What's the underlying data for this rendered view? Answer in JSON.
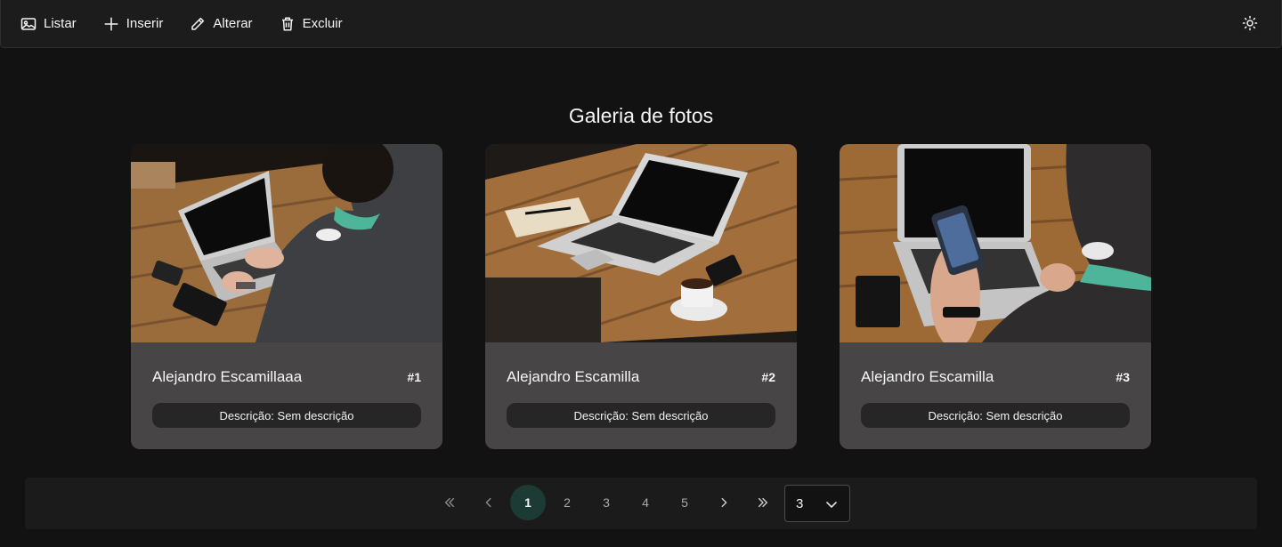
{
  "nav": {
    "list_label": "Listar",
    "insert_label": "Inserir",
    "edit_label": "Alterar",
    "delete_label": "Excluir"
  },
  "page": {
    "title": "Galeria de fotos"
  },
  "cards": [
    {
      "author": "Alejandro Escamillaaa",
      "id": "#1",
      "description": "Descrição: Sem descrição",
      "photo": "man-typing-on-laptop"
    },
    {
      "author": "Alejandro Escamilla",
      "id": "#2",
      "description": "Descrição: Sem descrição",
      "photo": "laptop-with-coffee-and-notebook"
    },
    {
      "author": "Alejandro Escamilla",
      "id": "#3",
      "description": "Descrição: Sem descrição",
      "photo": "man-holding-phone-by-laptop"
    }
  ],
  "pagination": {
    "pages": [
      "1",
      "2",
      "3",
      "4",
      "5"
    ],
    "current_page": "1",
    "page_size": "3"
  },
  "icons": {
    "list": "image-gallery-icon",
    "insert": "plus-icon",
    "edit": "pencil-icon",
    "delete": "trash-icon",
    "theme": "sun-icon",
    "first": "double-chevron-left-icon",
    "prev": "chevron-left-icon",
    "next": "chevron-right-icon",
    "last": "double-chevron-right-icon",
    "dropdown": "chevron-down-icon"
  },
  "colors": {
    "background": "#121212",
    "topbar": "#1c1c1c",
    "card": "#474545",
    "description_pill": "#262626",
    "active_page": "#1b3b34"
  }
}
